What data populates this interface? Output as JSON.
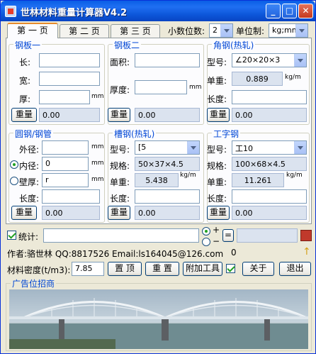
{
  "window": {
    "title": "世林材料重量计算器V4.2"
  },
  "tabs": [
    {
      "label": "第 一 页"
    },
    {
      "label": "第 二 页"
    },
    {
      "label": "第 三 页"
    }
  ],
  "toolbar": {
    "decimals_label": "小数位数:",
    "decimals_value": "2",
    "unit_label": "单位制:",
    "unit_value": "kg;mm"
  },
  "plate1": {
    "title": "钢板一",
    "length_label": "长:",
    "width_label": "宽:",
    "thickness_label": "厚:",
    "unit": "mm",
    "weigh_button": "重量",
    "result": "0.00"
  },
  "plate2": {
    "title": "钢板二",
    "area_label": "面积:",
    "thickness_label": "厚度:",
    "unit": "mm",
    "weigh_button": "重量",
    "result": "0.00"
  },
  "angle": {
    "title": "角钢(热轧)",
    "model_label": "型号:",
    "model_value": "∠20×20×3",
    "unit_weight_label": "单重:",
    "unit_weight_value": "0.889",
    "unit_weight_unit": "kg/m",
    "length_label": "长度:",
    "weigh_button": "重量",
    "result": "0.00"
  },
  "round": {
    "title": "圆钢/钢管",
    "outer_label": "外径:",
    "inner_label": "内径:",
    "inner_value": "0",
    "wall_label": "壁厚:",
    "wall_value": "r",
    "unit": "mm",
    "length_label": "长度:",
    "weigh_button": "重量",
    "result": "0.00"
  },
  "channel": {
    "title": "槽钢(热轧)",
    "model_label": "型号:",
    "model_value": "[5",
    "spec_label": "规格:",
    "spec_value": "50×37×4.5",
    "unit_weight_label": "单重:",
    "unit_weight_value": "5.438",
    "unit_weight_unit": "kg/m",
    "length_label": "长度:",
    "weigh_button": "重量",
    "result": "0.00"
  },
  "ibeam": {
    "title": "工字钢",
    "model_label": "型号:",
    "model_value": "工10",
    "spec_label": "规格:",
    "spec_value": "100×68×4.5",
    "unit_weight_label": "单重:",
    "unit_weight_value": "11.261",
    "unit_weight_unit": "kg/m",
    "length_label": "长度:",
    "weigh_button": "重量",
    "result": "0.00"
  },
  "stats": {
    "label": "统计:",
    "plus": "+",
    "minus": "−",
    "equals": "="
  },
  "footer": {
    "author": "作者:骆世林  QQ:8817526  Email:ls164045@126.com",
    "count": "0",
    "density_label": "材料密度(t/m3):",
    "density_value": "7.85",
    "top_button": "置 顶",
    "reset_button": "重 置",
    "tools_button": "附加工具",
    "about_button": "关于",
    "exit_button": "退出"
  },
  "ad": {
    "title": "广告位招商"
  }
}
